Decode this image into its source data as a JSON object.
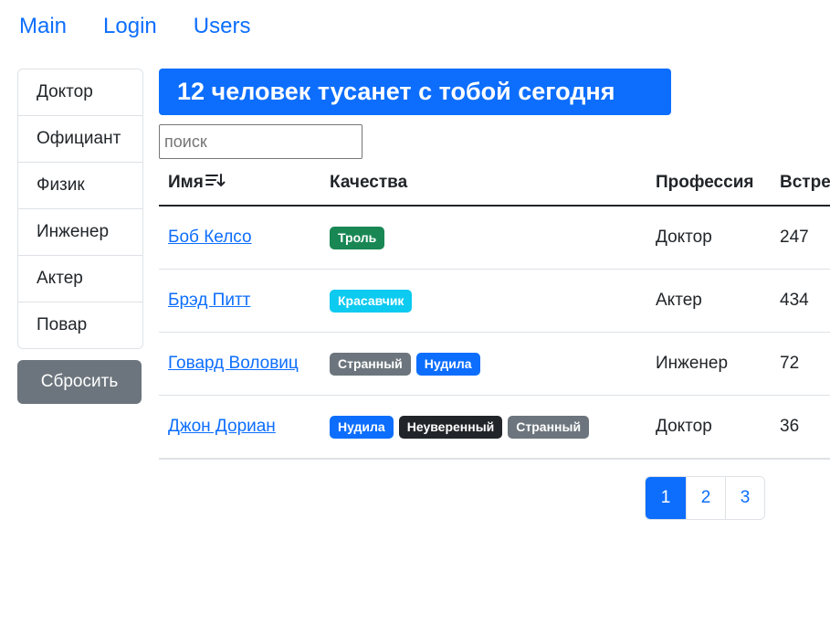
{
  "nav": {
    "items": [
      {
        "label": "Main"
      },
      {
        "label": "Login"
      },
      {
        "label": "Users"
      }
    ]
  },
  "sidebar": {
    "items": [
      {
        "label": "Доктор"
      },
      {
        "label": "Официант"
      },
      {
        "label": "Физик"
      },
      {
        "label": "Инженер"
      },
      {
        "label": "Актер"
      },
      {
        "label": "Повар"
      }
    ],
    "reset_label": "Сбросить"
  },
  "headline": "12 человек тусанет с тобой сегодня",
  "search": {
    "placeholder": "поиск",
    "value": ""
  },
  "table": {
    "headers": {
      "name": "Имя",
      "qualities": "Качества",
      "profession": "Профессия",
      "meetings": "Встре"
    },
    "rows": [
      {
        "name": "Боб Келсо",
        "qualities": [
          {
            "label": "Троль",
            "color": "#198754"
          }
        ],
        "profession": "Доктор",
        "meetings": "247"
      },
      {
        "name": "Брэд Питт",
        "qualities": [
          {
            "label": "Красавчик",
            "color": "#0dcaf0"
          }
        ],
        "profession": "Актер",
        "meetings": "434"
      },
      {
        "name": "Говард Воловиц",
        "qualities": [
          {
            "label": "Странный",
            "color": "#6c757d"
          },
          {
            "label": "Нудила",
            "color": "#0d6efd"
          }
        ],
        "profession": "Инженер",
        "meetings": "72"
      },
      {
        "name": "Джон Дориан",
        "qualities": [
          {
            "label": "Нудила",
            "color": "#0d6efd"
          },
          {
            "label": "Неуверенный",
            "color": "#212529"
          },
          {
            "label": "Странный",
            "color": "#6c757d"
          }
        ],
        "profession": "Доктор",
        "meetings": "36"
      }
    ]
  },
  "pagination": {
    "pages": [
      "1",
      "2",
      "3"
    ],
    "active": "1"
  },
  "colors": {
    "primary": "#0d6efd",
    "secondary": "#6c757d",
    "success": "#198754",
    "info": "#0dcaf0",
    "dark": "#212529"
  }
}
